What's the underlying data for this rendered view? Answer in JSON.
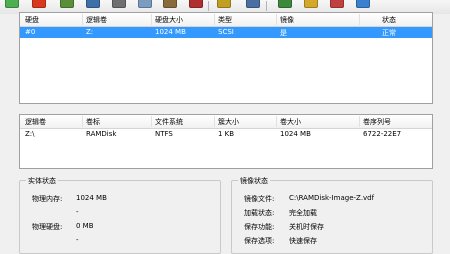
{
  "toolbar": {
    "buttons": [
      {
        "icon": "disk-add-green-icon",
        "color": "#4caf50"
      },
      {
        "icon": "disk-remove-red-icon",
        "color": "#d9381e"
      },
      {
        "icon": "disk-edit-icon",
        "color": "#5a8f3a"
      },
      {
        "icon": "disk-save-icon",
        "color": "#3f6fa8"
      },
      {
        "icon": "disk-load-icon",
        "color": "#6f6f6f"
      },
      {
        "icon": "disk-copy-icon",
        "color": "#7a9cc0"
      },
      {
        "icon": "disk-lock-icon",
        "color": "#8a6a3a"
      },
      {
        "icon": "disk-delete-icon",
        "color": "#b03030"
      },
      {
        "icon": "search-icon",
        "color": "#c0a020"
      },
      {
        "icon": "settings-icon",
        "color": "#4a6fa0"
      },
      {
        "icon": "image-icon",
        "color": "#3d8a3d"
      },
      {
        "icon": "folder-icon",
        "color": "#d4a82a"
      },
      {
        "icon": "export-icon",
        "color": "#c04040"
      },
      {
        "icon": "help-icon",
        "color": "#3a7fd0"
      }
    ]
  },
  "disks": {
    "columns": [
      "硬盘",
      "逻辑卷",
      "硬盘大小",
      "类型",
      "镜像",
      "状态"
    ],
    "rows": [
      {
        "disk": "#0",
        "volume": "Z:",
        "size": "1024 MB",
        "type": "SCSI",
        "image": "是",
        "status": "正常"
      }
    ]
  },
  "volumes": {
    "columns": [
      "逻辑卷",
      "卷标",
      "文件系统",
      "簇大小",
      "卷大小",
      "卷序列号"
    ],
    "rows": [
      {
        "volume": "Z:\\",
        "label": "RAMDisk",
        "fs": "NTFS",
        "cluster": "1 KB",
        "vol_size": "1024 MB",
        "serial": "6722-22E7"
      }
    ]
  },
  "entity_status": {
    "title": "实体状态",
    "memory_label": "物理内存:",
    "memory_value": "1024 MB",
    "memory_sub": "-",
    "disk_label": "物理硬盘:",
    "disk_value": "0 MB",
    "disk_sub": "-"
  },
  "image_status": {
    "title": "镜像状态",
    "file_label": "镜像文件:",
    "file_value": "C:\\RAMDisk-Image-Z.vdf",
    "load_label": "加载状态:",
    "load_value": "完全加载",
    "save_func_label": "保存功能:",
    "save_func_value": "关机时保存",
    "save_opt_label": "保存选项:",
    "save_opt_value": "快速保存"
  }
}
